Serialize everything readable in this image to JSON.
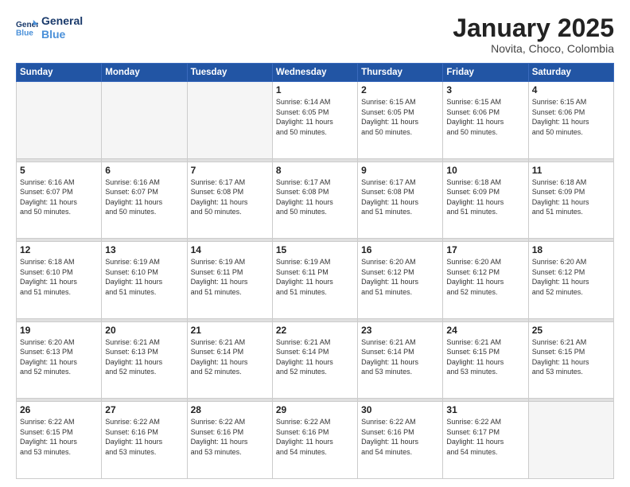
{
  "header": {
    "logo_line1": "General",
    "logo_line2": "Blue",
    "title": "January 2025",
    "subtitle": "Novita, Choco, Colombia"
  },
  "days_of_week": [
    "Sunday",
    "Monday",
    "Tuesday",
    "Wednesday",
    "Thursday",
    "Friday",
    "Saturday"
  ],
  "weeks": [
    [
      {
        "day": "",
        "info": ""
      },
      {
        "day": "",
        "info": ""
      },
      {
        "day": "",
        "info": ""
      },
      {
        "day": "1",
        "info": "Sunrise: 6:14 AM\nSunset: 6:05 PM\nDaylight: 11 hours\nand 50 minutes."
      },
      {
        "day": "2",
        "info": "Sunrise: 6:15 AM\nSunset: 6:05 PM\nDaylight: 11 hours\nand 50 minutes."
      },
      {
        "day": "3",
        "info": "Sunrise: 6:15 AM\nSunset: 6:06 PM\nDaylight: 11 hours\nand 50 minutes."
      },
      {
        "day": "4",
        "info": "Sunrise: 6:15 AM\nSunset: 6:06 PM\nDaylight: 11 hours\nand 50 minutes."
      }
    ],
    [
      {
        "day": "5",
        "info": "Sunrise: 6:16 AM\nSunset: 6:07 PM\nDaylight: 11 hours\nand 50 minutes."
      },
      {
        "day": "6",
        "info": "Sunrise: 6:16 AM\nSunset: 6:07 PM\nDaylight: 11 hours\nand 50 minutes."
      },
      {
        "day": "7",
        "info": "Sunrise: 6:17 AM\nSunset: 6:08 PM\nDaylight: 11 hours\nand 50 minutes."
      },
      {
        "day": "8",
        "info": "Sunrise: 6:17 AM\nSunset: 6:08 PM\nDaylight: 11 hours\nand 50 minutes."
      },
      {
        "day": "9",
        "info": "Sunrise: 6:17 AM\nSunset: 6:08 PM\nDaylight: 11 hours\nand 51 minutes."
      },
      {
        "day": "10",
        "info": "Sunrise: 6:18 AM\nSunset: 6:09 PM\nDaylight: 11 hours\nand 51 minutes."
      },
      {
        "day": "11",
        "info": "Sunrise: 6:18 AM\nSunset: 6:09 PM\nDaylight: 11 hours\nand 51 minutes."
      }
    ],
    [
      {
        "day": "12",
        "info": "Sunrise: 6:18 AM\nSunset: 6:10 PM\nDaylight: 11 hours\nand 51 minutes."
      },
      {
        "day": "13",
        "info": "Sunrise: 6:19 AM\nSunset: 6:10 PM\nDaylight: 11 hours\nand 51 minutes."
      },
      {
        "day": "14",
        "info": "Sunrise: 6:19 AM\nSunset: 6:11 PM\nDaylight: 11 hours\nand 51 minutes."
      },
      {
        "day": "15",
        "info": "Sunrise: 6:19 AM\nSunset: 6:11 PM\nDaylight: 11 hours\nand 51 minutes."
      },
      {
        "day": "16",
        "info": "Sunrise: 6:20 AM\nSunset: 6:12 PM\nDaylight: 11 hours\nand 51 minutes."
      },
      {
        "day": "17",
        "info": "Sunrise: 6:20 AM\nSunset: 6:12 PM\nDaylight: 11 hours\nand 52 minutes."
      },
      {
        "day": "18",
        "info": "Sunrise: 6:20 AM\nSunset: 6:12 PM\nDaylight: 11 hours\nand 52 minutes."
      }
    ],
    [
      {
        "day": "19",
        "info": "Sunrise: 6:20 AM\nSunset: 6:13 PM\nDaylight: 11 hours\nand 52 minutes."
      },
      {
        "day": "20",
        "info": "Sunrise: 6:21 AM\nSunset: 6:13 PM\nDaylight: 11 hours\nand 52 minutes."
      },
      {
        "day": "21",
        "info": "Sunrise: 6:21 AM\nSunset: 6:14 PM\nDaylight: 11 hours\nand 52 minutes."
      },
      {
        "day": "22",
        "info": "Sunrise: 6:21 AM\nSunset: 6:14 PM\nDaylight: 11 hours\nand 52 minutes."
      },
      {
        "day": "23",
        "info": "Sunrise: 6:21 AM\nSunset: 6:14 PM\nDaylight: 11 hours\nand 53 minutes."
      },
      {
        "day": "24",
        "info": "Sunrise: 6:21 AM\nSunset: 6:15 PM\nDaylight: 11 hours\nand 53 minutes."
      },
      {
        "day": "25",
        "info": "Sunrise: 6:21 AM\nSunset: 6:15 PM\nDaylight: 11 hours\nand 53 minutes."
      }
    ],
    [
      {
        "day": "26",
        "info": "Sunrise: 6:22 AM\nSunset: 6:15 PM\nDaylight: 11 hours\nand 53 minutes."
      },
      {
        "day": "27",
        "info": "Sunrise: 6:22 AM\nSunset: 6:16 PM\nDaylight: 11 hours\nand 53 minutes."
      },
      {
        "day": "28",
        "info": "Sunrise: 6:22 AM\nSunset: 6:16 PM\nDaylight: 11 hours\nand 53 minutes."
      },
      {
        "day": "29",
        "info": "Sunrise: 6:22 AM\nSunset: 6:16 PM\nDaylight: 11 hours\nand 54 minutes."
      },
      {
        "day": "30",
        "info": "Sunrise: 6:22 AM\nSunset: 6:16 PM\nDaylight: 11 hours\nand 54 minutes."
      },
      {
        "day": "31",
        "info": "Sunrise: 6:22 AM\nSunset: 6:17 PM\nDaylight: 11 hours\nand 54 minutes."
      },
      {
        "day": "",
        "info": ""
      }
    ]
  ]
}
